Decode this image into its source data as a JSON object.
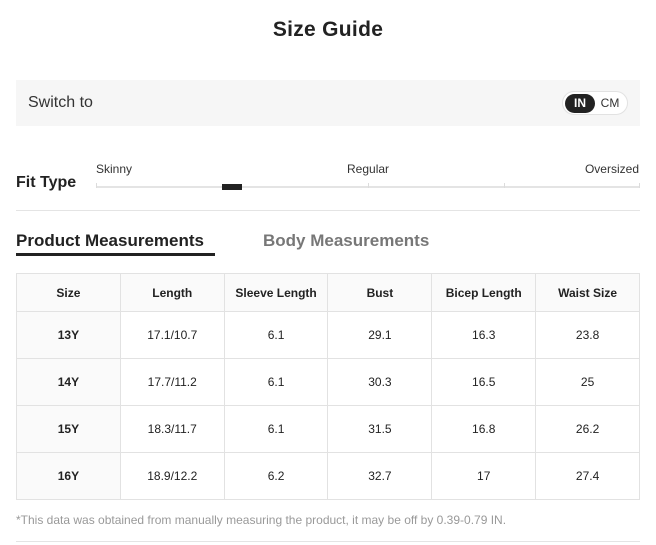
{
  "title": "Size Guide",
  "switch": {
    "label": "Switch to",
    "options": [
      "IN",
      "CM"
    ],
    "selected": "IN"
  },
  "fit": {
    "label": "Fit Type",
    "scale": [
      "Skinny",
      "Regular",
      "Oversized"
    ]
  },
  "tabs": {
    "product": "Product Measurements",
    "body": "Body Measurements",
    "active": "product"
  },
  "table": {
    "headers": [
      "Size",
      "Length",
      "Sleeve Length",
      "Bust",
      "Bicep Length",
      "Waist Size"
    ],
    "rows": [
      [
        "13Y",
        "17.1/10.7",
        "6.1",
        "29.1",
        "16.3",
        "23.8"
      ],
      [
        "14Y",
        "17.7/11.2",
        "6.1",
        "30.3",
        "16.5",
        "25"
      ],
      [
        "15Y",
        "18.3/11.7",
        "6.1",
        "31.5",
        "16.8",
        "26.2"
      ],
      [
        "16Y",
        "18.9/12.2",
        "6.2",
        "32.7",
        "17",
        "27.4"
      ]
    ]
  },
  "footnote": "*This data was obtained from manually measuring the product, it may be off by 0.39-0.79 IN."
}
